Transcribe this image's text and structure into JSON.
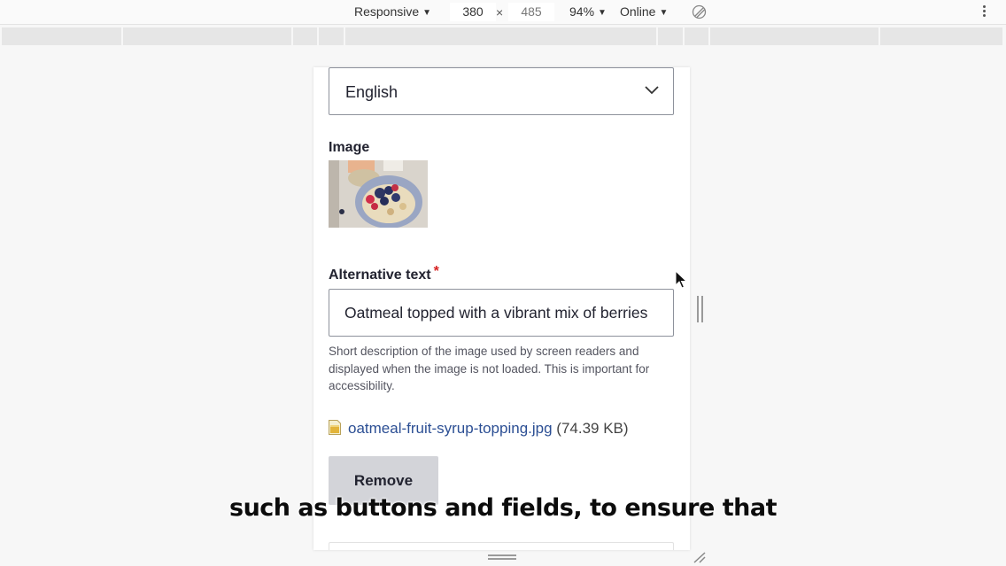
{
  "devtools": {
    "device": "Responsive",
    "width": "380",
    "times": "×",
    "height": "485",
    "zoom": "94%",
    "network": "Online",
    "rotate_icon": "rotate-icon",
    "more_icon": "more-vertical-icon"
  },
  "form": {
    "language_select": {
      "value": "English"
    },
    "image_label": "Image",
    "image_alt": "Oatmeal topped with a vibrant mix of berries",
    "alt_text_label": "Alternative text",
    "required_marker": "*",
    "alt_text_value": "Oatmeal topped with a vibrant mix of berries",
    "alt_text_description": "Short description of the image used by screen readers and displayed when the image is not loaded. This is important for accessibility.",
    "file_name": "oatmeal-fruit-syrup-topping.jpg",
    "file_size": "(74.39 KB)",
    "remove_button": "Remove"
  },
  "caption": "such as buttons and fields, to ensure that",
  "colors": {
    "link": "#2c4f94",
    "required": "#d72222",
    "button_bg": "#d3d4d9"
  }
}
